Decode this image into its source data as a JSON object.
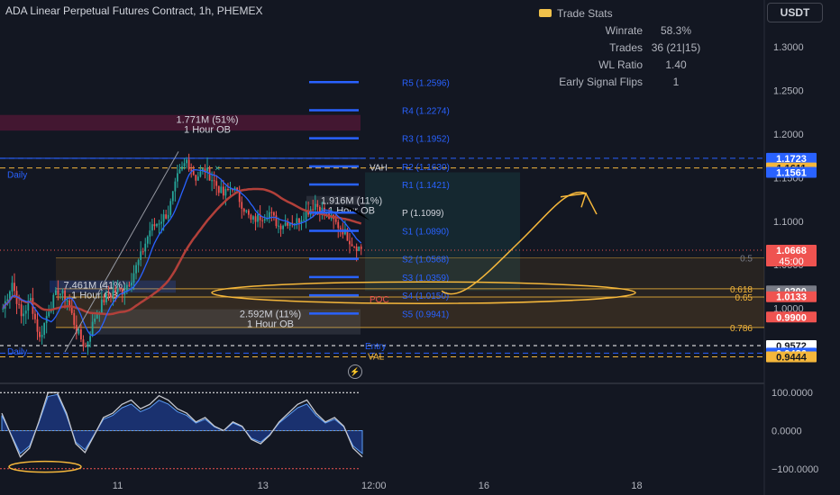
{
  "header": {
    "title": "ADA Linear Perpetual Futures Contract, 1h, PHEMEX"
  },
  "toolbar": {
    "currency": "USDT"
  },
  "trade_stats": {
    "title": "Trade Stats",
    "rows": [
      {
        "label": "Winrate",
        "value": "58.3%"
      },
      {
        "label": "Trades",
        "value": "36 (21|15)"
      },
      {
        "label": "WL Ratio",
        "value": "1.40"
      },
      {
        "label": "Early Signal Flips",
        "value": "1"
      }
    ]
  },
  "colors": {
    "background": "#131722",
    "up": "#26a69a",
    "down": "#ef5350",
    "pivot": "#2962ff",
    "annotation": "#f5b73b",
    "ma": "#b2403a",
    "grid_text": "#b2b5be"
  },
  "chart_data": [
    {
      "type": "candlestick",
      "y_axis": {
        "min": 0.918,
        "max": 1.325,
        "ticks": [
          "1.3000",
          "1.2500",
          "1.2000",
          "1.1500",
          "1.1000",
          "1.0500",
          "1.0000",
          "0.9500"
        ]
      },
      "x_axis": {
        "ticks": [
          {
            "label": "11",
            "pos": 0.14
          },
          {
            "label": "13",
            "pos": 0.313
          },
          {
            "label": "12:00",
            "pos": 0.445
          },
          {
            "label": "16",
            "pos": 0.576
          },
          {
            "label": "18",
            "pos": 0.758
          }
        ]
      },
      "price_path": [
        1.0,
        1.03,
        0.99,
        1.01,
        0.965,
        1.0,
        1.02,
        1.01,
        0.975,
        0.955,
        0.99,
        1.01,
        1.02,
        1.02,
        1.035,
        1.06,
        1.09,
        1.1,
        1.11,
        1.15,
        1.17,
        1.15,
        1.16,
        1.145,
        1.13,
        1.14,
        1.12,
        1.1,
        1.105,
        1.11,
        1.095,
        1.1,
        1.1,
        1.11,
        1.12,
        1.11,
        1.1,
        1.09,
        1.075,
        1.068
      ],
      "pivots": [
        {
          "label": "R5 (1.2596)",
          "value": 1.2596
        },
        {
          "label": "R4 (1.2274)",
          "value": 1.2274
        },
        {
          "label": "R3 (1.1952)",
          "value": 1.1952
        },
        {
          "label": "R2 (1.1630)",
          "value": 1.163
        },
        {
          "label": "R1 (1.1421)",
          "value": 1.1421
        },
        {
          "label": "P (1.1099)",
          "value": 1.1099
        },
        {
          "label": "S1 (1.0890)",
          "value": 1.089
        },
        {
          "label": "S2 (1.0568)",
          "value": 1.0568
        },
        {
          "label": "S3 (1.0359)",
          "value": 1.0359
        },
        {
          "label": "S4 (1.0150)",
          "value": 1.015
        },
        {
          "label": "S5 (0.9941)",
          "value": 0.9941
        }
      ],
      "order_blocks": [
        {
          "volume": "1.771M (51%)",
          "label": "1 Hour OB",
          "top": 1.222,
          "bottom": 1.204
        },
        {
          "volume": "1.916M (11%)",
          "label": "1 Hour OB",
          "top": 1.129,
          "bottom": 1.119
        },
        {
          "volume": "7.461M (41%)",
          "label": "1 Hour OB",
          "top": 1.032,
          "bottom": 1.018
        },
        {
          "volume": "2.592M (11%)",
          "label": "1 Hour OB",
          "top": 0.999,
          "bottom": 0.97
        }
      ],
      "level_labels": [
        "VAH",
        "POC",
        "Entry",
        "VAL",
        "Daily",
        "Daily"
      ],
      "fib_levels": [
        {
          "label": "0.5",
          "value": 1.058
        },
        {
          "label": "0.618",
          "value": 1.0225
        },
        {
          "label": "0.65",
          "value": 1.013
        },
        {
          "label": "0.786",
          "value": 0.978
        }
      ],
      "price_tags": [
        {
          "text": "1.1723",
          "value": 1.1723,
          "color": "#2962ff"
        },
        {
          "text": "1.1611",
          "value": 1.1611,
          "color": "#f5b73b"
        },
        {
          "text": "1.1561",
          "value": 1.1561,
          "color": "#2962ff"
        },
        {
          "text": "1.0668",
          "value": 1.0668,
          "color": "#ef5350",
          "sub": "45:00"
        },
        {
          "text": "1.0200",
          "value": 1.02,
          "color": "#787b86"
        },
        {
          "text": "1.0133",
          "value": 1.0133,
          "color": "#ef5350"
        },
        {
          "text": "0.9900",
          "value": 0.99,
          "color": "#ef5350"
        },
        {
          "text": "0.9572",
          "value": 0.9572,
          "color": "#ffffff"
        },
        {
          "text": "0.9486",
          "value": 0.9486,
          "color": "#2962ff"
        },
        {
          "text": "0.9444",
          "value": 0.9444,
          "color": "#f5b73b"
        }
      ]
    },
    {
      "type": "area",
      "y_axis": {
        "min": -110,
        "max": 110,
        "ticks": [
          "100.0000",
          "0.0000",
          "−100.0000"
        ]
      },
      "oscillator": [
        40,
        -10,
        -60,
        -40,
        20,
        90,
        95,
        40,
        -30,
        -50,
        -10,
        30,
        40,
        60,
        70,
        50,
        60,
        80,
        70,
        50,
        40,
        20,
        30,
        10,
        0,
        20,
        10,
        -20,
        -30,
        -10,
        20,
        40,
        60,
        70,
        40,
        20,
        30,
        10,
        -40,
        -60
      ]
    }
  ]
}
